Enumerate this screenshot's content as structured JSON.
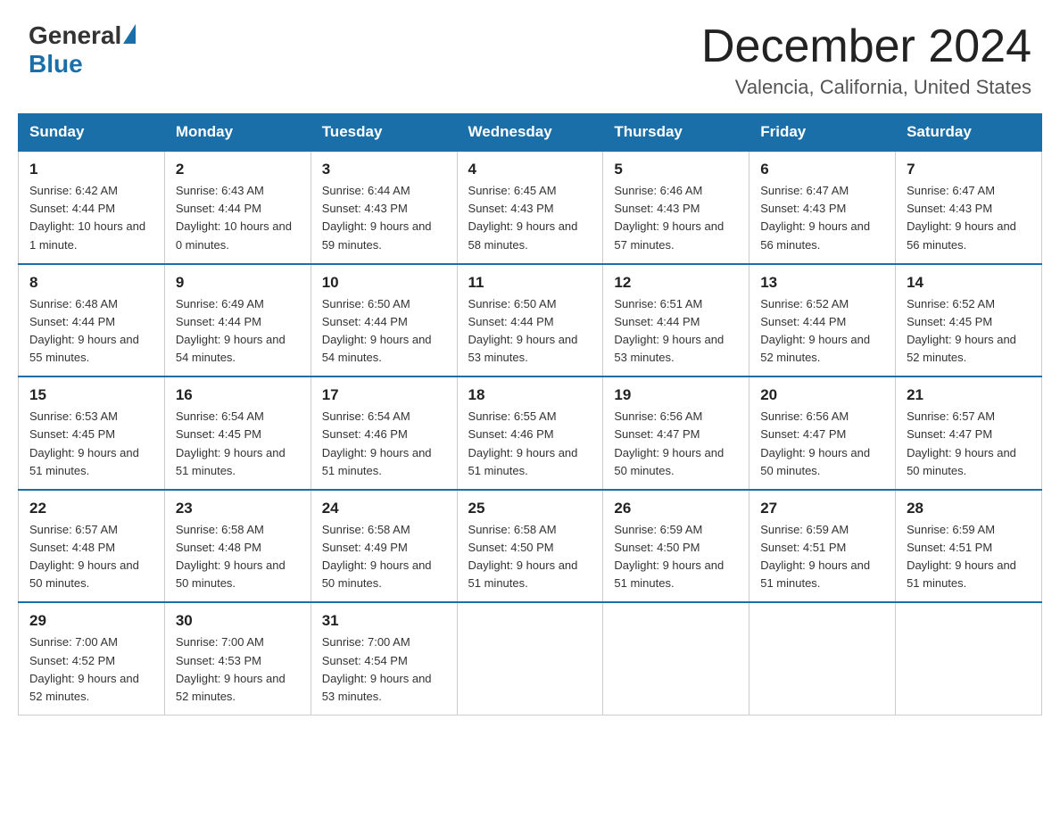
{
  "header": {
    "logo_general": "General",
    "logo_blue": "Blue",
    "month_title": "December 2024",
    "location": "Valencia, California, United States"
  },
  "days_of_week": [
    "Sunday",
    "Monday",
    "Tuesday",
    "Wednesday",
    "Thursday",
    "Friday",
    "Saturday"
  ],
  "weeks": [
    [
      {
        "day": "1",
        "sunrise": "6:42 AM",
        "sunset": "4:44 PM",
        "daylight": "10 hours and 1 minute."
      },
      {
        "day": "2",
        "sunrise": "6:43 AM",
        "sunset": "4:44 PM",
        "daylight": "10 hours and 0 minutes."
      },
      {
        "day": "3",
        "sunrise": "6:44 AM",
        "sunset": "4:43 PM",
        "daylight": "9 hours and 59 minutes."
      },
      {
        "day": "4",
        "sunrise": "6:45 AM",
        "sunset": "4:43 PM",
        "daylight": "9 hours and 58 minutes."
      },
      {
        "day": "5",
        "sunrise": "6:46 AM",
        "sunset": "4:43 PM",
        "daylight": "9 hours and 57 minutes."
      },
      {
        "day": "6",
        "sunrise": "6:47 AM",
        "sunset": "4:43 PM",
        "daylight": "9 hours and 56 minutes."
      },
      {
        "day": "7",
        "sunrise": "6:47 AM",
        "sunset": "4:43 PM",
        "daylight": "9 hours and 56 minutes."
      }
    ],
    [
      {
        "day": "8",
        "sunrise": "6:48 AM",
        "sunset": "4:44 PM",
        "daylight": "9 hours and 55 minutes."
      },
      {
        "day": "9",
        "sunrise": "6:49 AM",
        "sunset": "4:44 PM",
        "daylight": "9 hours and 54 minutes."
      },
      {
        "day": "10",
        "sunrise": "6:50 AM",
        "sunset": "4:44 PM",
        "daylight": "9 hours and 54 minutes."
      },
      {
        "day": "11",
        "sunrise": "6:50 AM",
        "sunset": "4:44 PM",
        "daylight": "9 hours and 53 minutes."
      },
      {
        "day": "12",
        "sunrise": "6:51 AM",
        "sunset": "4:44 PM",
        "daylight": "9 hours and 53 minutes."
      },
      {
        "day": "13",
        "sunrise": "6:52 AM",
        "sunset": "4:44 PM",
        "daylight": "9 hours and 52 minutes."
      },
      {
        "day": "14",
        "sunrise": "6:52 AM",
        "sunset": "4:45 PM",
        "daylight": "9 hours and 52 minutes."
      }
    ],
    [
      {
        "day": "15",
        "sunrise": "6:53 AM",
        "sunset": "4:45 PM",
        "daylight": "9 hours and 51 minutes."
      },
      {
        "day": "16",
        "sunrise": "6:54 AM",
        "sunset": "4:45 PM",
        "daylight": "9 hours and 51 minutes."
      },
      {
        "day": "17",
        "sunrise": "6:54 AM",
        "sunset": "4:46 PM",
        "daylight": "9 hours and 51 minutes."
      },
      {
        "day": "18",
        "sunrise": "6:55 AM",
        "sunset": "4:46 PM",
        "daylight": "9 hours and 51 minutes."
      },
      {
        "day": "19",
        "sunrise": "6:56 AM",
        "sunset": "4:47 PM",
        "daylight": "9 hours and 50 minutes."
      },
      {
        "day": "20",
        "sunrise": "6:56 AM",
        "sunset": "4:47 PM",
        "daylight": "9 hours and 50 minutes."
      },
      {
        "day": "21",
        "sunrise": "6:57 AM",
        "sunset": "4:47 PM",
        "daylight": "9 hours and 50 minutes."
      }
    ],
    [
      {
        "day": "22",
        "sunrise": "6:57 AM",
        "sunset": "4:48 PM",
        "daylight": "9 hours and 50 minutes."
      },
      {
        "day": "23",
        "sunrise": "6:58 AM",
        "sunset": "4:48 PM",
        "daylight": "9 hours and 50 minutes."
      },
      {
        "day": "24",
        "sunrise": "6:58 AM",
        "sunset": "4:49 PM",
        "daylight": "9 hours and 50 minutes."
      },
      {
        "day": "25",
        "sunrise": "6:58 AM",
        "sunset": "4:50 PM",
        "daylight": "9 hours and 51 minutes."
      },
      {
        "day": "26",
        "sunrise": "6:59 AM",
        "sunset": "4:50 PM",
        "daylight": "9 hours and 51 minutes."
      },
      {
        "day": "27",
        "sunrise": "6:59 AM",
        "sunset": "4:51 PM",
        "daylight": "9 hours and 51 minutes."
      },
      {
        "day": "28",
        "sunrise": "6:59 AM",
        "sunset": "4:51 PM",
        "daylight": "9 hours and 51 minutes."
      }
    ],
    [
      {
        "day": "29",
        "sunrise": "7:00 AM",
        "sunset": "4:52 PM",
        "daylight": "9 hours and 52 minutes."
      },
      {
        "day": "30",
        "sunrise": "7:00 AM",
        "sunset": "4:53 PM",
        "daylight": "9 hours and 52 minutes."
      },
      {
        "day": "31",
        "sunrise": "7:00 AM",
        "sunset": "4:54 PM",
        "daylight": "9 hours and 53 minutes."
      },
      null,
      null,
      null,
      null
    ]
  ]
}
